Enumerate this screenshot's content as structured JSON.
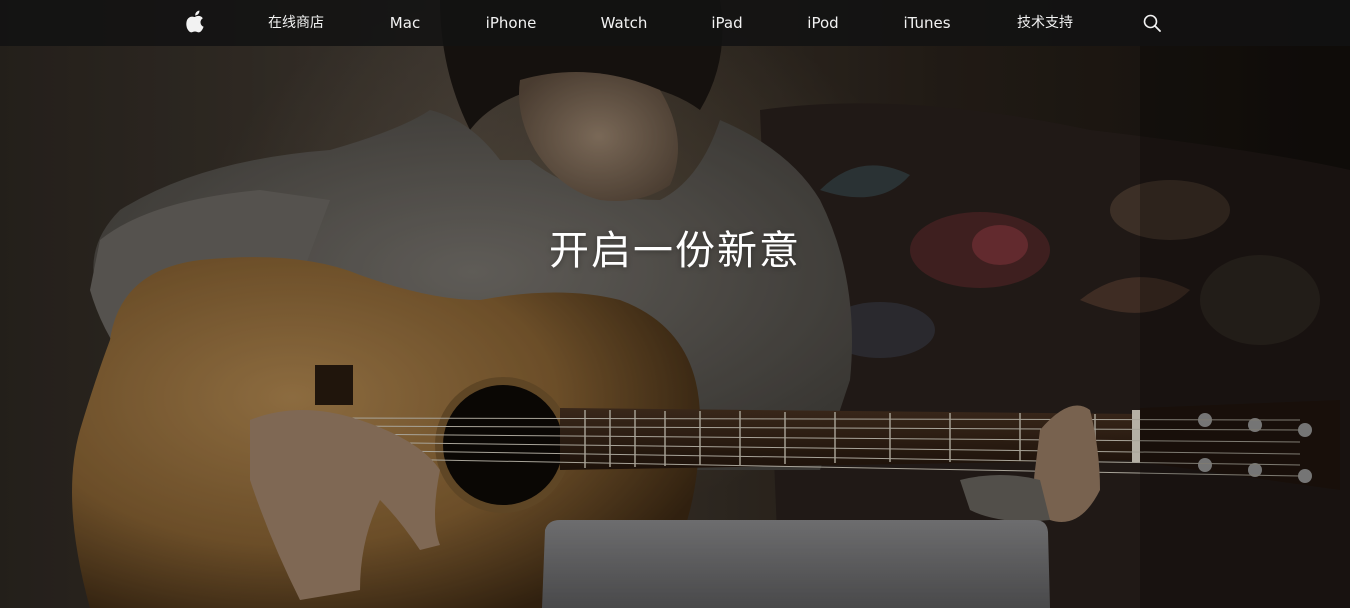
{
  "nav": {
    "logo_icon": "apple-logo-icon",
    "items": [
      {
        "label": "在线商店"
      },
      {
        "label": "Mac"
      },
      {
        "label": "iPhone"
      },
      {
        "label": "Watch"
      },
      {
        "label": "iPad"
      },
      {
        "label": "iPod"
      },
      {
        "label": "iTunes"
      },
      {
        "label": "技术支持"
      }
    ],
    "search_icon": "search-icon",
    "background": "#121212",
    "text_color": "#f2f2f2"
  },
  "hero": {
    "headline": "开启一份新意",
    "image": "girl-playing-acoustic-guitar-photo"
  }
}
